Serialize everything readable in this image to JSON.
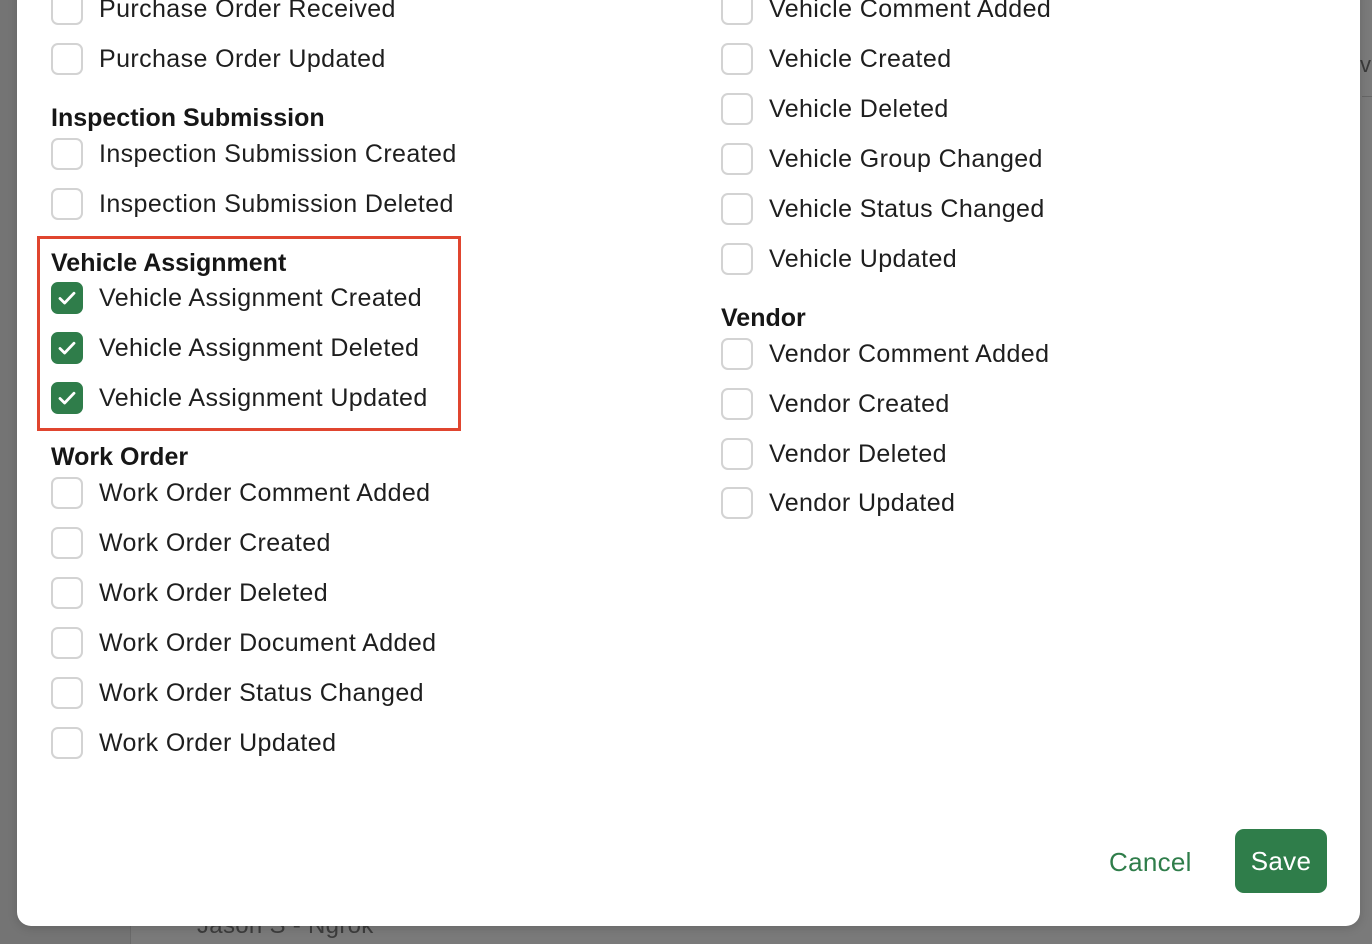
{
  "left_column": {
    "partial_top": {
      "items": [
        {
          "label": "Purchase Order Received",
          "checked": false
        },
        {
          "label": "Purchase Order Updated",
          "checked": false
        }
      ]
    },
    "inspection_submission": {
      "title": "Inspection Submission",
      "items": [
        {
          "label": "Inspection Submission Created",
          "checked": false
        },
        {
          "label": "Inspection Submission Deleted",
          "checked": false
        }
      ]
    },
    "vehicle_assignment": {
      "title": "Vehicle Assignment",
      "items": [
        {
          "label": "Vehicle Assignment Created",
          "checked": true
        },
        {
          "label": "Vehicle Assignment Deleted",
          "checked": true
        },
        {
          "label": "Vehicle Assignment Updated",
          "checked": true
        }
      ]
    },
    "work_order": {
      "title": "Work Order",
      "items": [
        {
          "label": "Work Order Comment Added",
          "checked": false
        },
        {
          "label": "Work Order Created",
          "checked": false
        },
        {
          "label": "Work Order Deleted",
          "checked": false
        },
        {
          "label": "Work Order Document Added",
          "checked": false
        },
        {
          "label": "Work Order Status Changed",
          "checked": false
        },
        {
          "label": "Work Order Updated",
          "checked": false
        }
      ]
    }
  },
  "right_column": {
    "vehicle": {
      "items": [
        {
          "label": "Vehicle Comment Added",
          "checked": false
        },
        {
          "label": "Vehicle Created",
          "checked": false
        },
        {
          "label": "Vehicle Deleted",
          "checked": false
        },
        {
          "label": "Vehicle Group Changed",
          "checked": false
        },
        {
          "label": "Vehicle Status Changed",
          "checked": false
        },
        {
          "label": "Vehicle Updated",
          "checked": false
        }
      ]
    },
    "vendor": {
      "title": "Vendor",
      "items": [
        {
          "label": "Vendor Comment Added",
          "checked": false
        },
        {
          "label": "Vendor Created",
          "checked": false
        },
        {
          "label": "Vendor Deleted",
          "checked": false
        },
        {
          "label": "Vendor Updated",
          "checked": false
        }
      ]
    }
  },
  "footer": {
    "cancel_label": "Cancel",
    "save_label": "Save"
  },
  "background": {
    "row_text": "Jason S - Ngrok",
    "right_glyph": "v"
  },
  "colors": {
    "accent": "#2f7d4a",
    "highlight": "#e0452f",
    "checkbox_border": "#d3d3d3"
  }
}
